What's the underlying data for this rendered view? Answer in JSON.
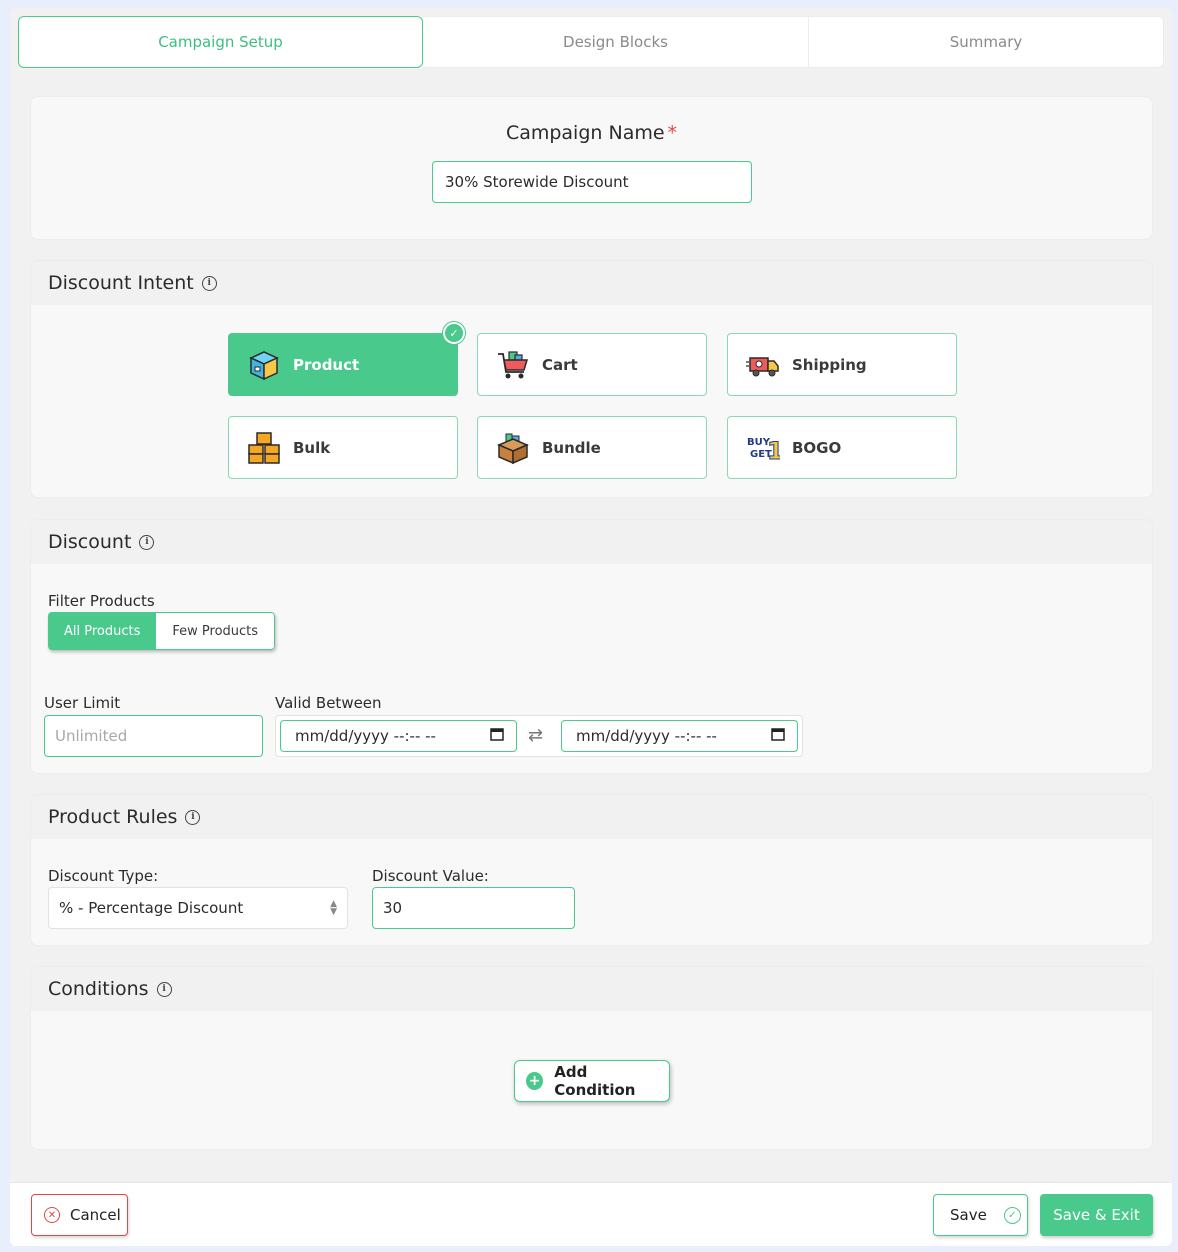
{
  "tabs": [
    {
      "label": "Campaign Setup",
      "active": true
    },
    {
      "label": "Design Blocks",
      "active": false
    },
    {
      "label": "Summary",
      "active": false
    }
  ],
  "campaign": {
    "label": "Campaign Name",
    "required_mark": "*",
    "value": "30% Storewide Discount"
  },
  "intent": {
    "title": "Discount Intent",
    "selected": "Product",
    "options": [
      {
        "label": "Product",
        "icon": "package-box-icon"
      },
      {
        "label": "Cart",
        "icon": "shopping-cart-icon"
      },
      {
        "label": "Shipping",
        "icon": "delivery-truck-icon"
      },
      {
        "label": "Bulk",
        "icon": "stacked-boxes-icon"
      },
      {
        "label": "Bundle",
        "icon": "bundle-box-icon"
      },
      {
        "label": "BOGO",
        "icon": "buy-get-one-icon"
      }
    ],
    "bogo_icon_text": [
      "BUY",
      "GET",
      "1"
    ]
  },
  "discount": {
    "title": "Discount",
    "filter_label": "Filter Products",
    "filter_options": [
      "All Products",
      "Few Products"
    ],
    "filter_selected": "All Products",
    "user_limit_label": "User Limit",
    "user_limit_placeholder": "Unlimited",
    "valid_between_label": "Valid Between",
    "date_start_placeholder": "mm/dd/yyyy --:-- --",
    "date_end_placeholder": "mm/dd/yyyy --:-- --"
  },
  "rules": {
    "title": "Product Rules",
    "type_label": "Discount Type:",
    "type_value": "% - Percentage Discount",
    "value_label": "Discount Value:",
    "value": "30"
  },
  "conditions": {
    "title": "Conditions",
    "add_label": "Add Condition"
  },
  "footer": {
    "cancel_label": "Cancel",
    "save_label": "Save",
    "save_exit_label": "Save & Exit"
  },
  "colors": {
    "accent": "#4ac98c",
    "danger": "#e04848"
  }
}
